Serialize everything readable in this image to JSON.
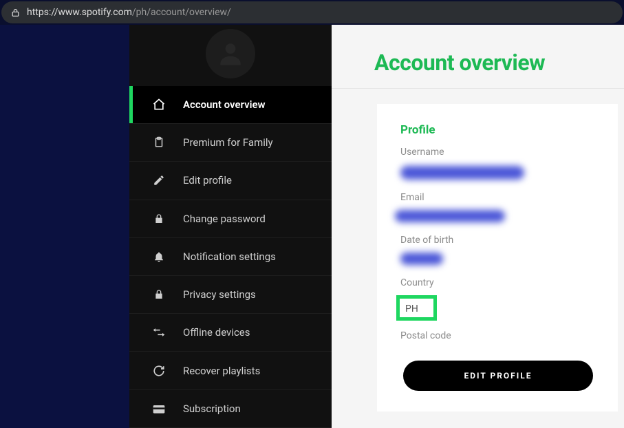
{
  "url": {
    "host": "https://www.spotify.com",
    "path": "/ph/account/overview/"
  },
  "sidebar": {
    "items": [
      {
        "label": "Account overview"
      },
      {
        "label": "Premium for Family"
      },
      {
        "label": "Edit profile"
      },
      {
        "label": "Change password"
      },
      {
        "label": "Notification settings"
      },
      {
        "label": "Privacy settings"
      },
      {
        "label": "Offline devices"
      },
      {
        "label": "Recover playlists"
      },
      {
        "label": "Subscription"
      }
    ]
  },
  "page": {
    "title": "Account overview"
  },
  "profile": {
    "section_title": "Profile",
    "labels": {
      "username": "Username",
      "email": "Email",
      "dob": "Date of birth",
      "country": "Country",
      "postal": "Postal code"
    },
    "country_value": "PH",
    "edit_button": "EDIT PROFILE"
  }
}
